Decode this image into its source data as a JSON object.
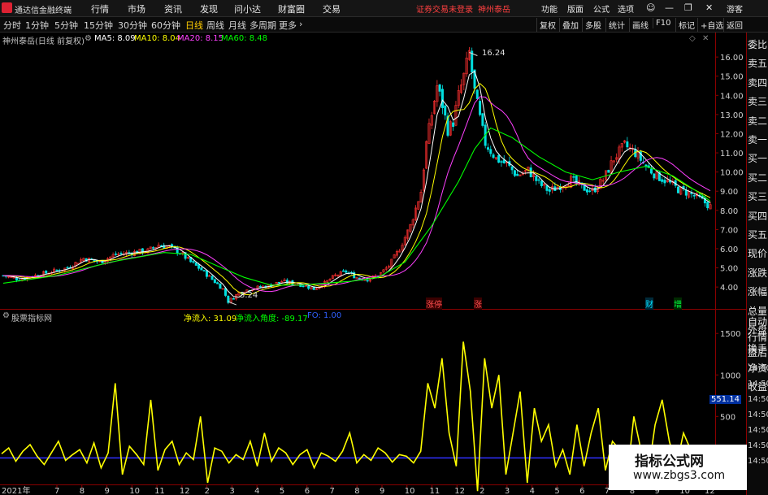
{
  "menubar": {
    "app_name": "通达信金融终端",
    "items": [
      "行情",
      "市场",
      "资讯",
      "发现",
      "问小达",
      "财富圈",
      "交易"
    ],
    "login_warning": "证券交易未登录",
    "stock_name": "神州泰岳",
    "right_items": [
      "功能",
      "版面",
      "公式",
      "选项"
    ],
    "guest": "游客"
  },
  "toolbar": {
    "periods": [
      "分时",
      "1分钟",
      "5分钟",
      "15分钟",
      "30分钟",
      "60分钟",
      "日线",
      "周线",
      "月线",
      "多周期",
      "更多"
    ],
    "active_period": "日线",
    "right_buttons": [
      "复权",
      "叠加",
      "多股",
      "统计",
      "画线",
      "F10",
      "标记",
      "+自选",
      "返回"
    ]
  },
  "info": {
    "title": "神州泰岳(日线 前复权)",
    "ma5": "MA5: 8.09",
    "ma10": "MA10: 8.04",
    "ma20": "MA20: 8.15",
    "ma60": "MA60: 8.48"
  },
  "side_panel": [
    "委比",
    "卖五",
    "卖四",
    "卖三",
    "卖二",
    "卖一",
    "买一",
    "买二",
    "买三",
    "买四",
    "买五",
    "现价",
    "涨跌",
    "涨幅",
    "总量",
    "外盘",
    "换手",
    "净资",
    "收益"
  ],
  "side_panel_lower": [
    "自动",
    "行情",
    "盘后",
    "14:50",
    "14:50",
    "14:50",
    "14:50",
    "14:50",
    "14:50",
    "14:50"
  ],
  "indicator": {
    "name": "股票指标网",
    "line1": "净流入: 31.09",
    "line2": "净流入角度: -89.17",
    "line3": "FO: 1.00",
    "current_value": "551.14"
  },
  "price_axis": [
    "16.00",
    "15.00",
    "14.00",
    "13.00",
    "12.00",
    "11.00",
    "10.00",
    "9.00",
    "8.00",
    "7.00",
    "6.00",
    "5.00",
    "4.00"
  ],
  "indicator_axis": [
    "1500",
    "1000",
    "500",
    "0"
  ],
  "annotations": {
    "high": "16.24",
    "low": "3.24"
  },
  "date_axis": {
    "year": "2021年",
    "months": [
      "7",
      "8",
      "9",
      "10",
      "11",
      "12",
      "2",
      "3",
      "4",
      "5",
      "6",
      "7",
      "8",
      "9",
      "10",
      "11",
      "12",
      "2",
      "3",
      "4",
      "5",
      "6",
      "7",
      "8",
      "9",
      "10",
      "12"
    ]
  },
  "event_tags": [
    "涨停",
    "涨",
    "财",
    "增"
  ],
  "watermark": {
    "line1": "指标公式网",
    "line2": "www.zbgs3.com"
  },
  "colors": {
    "up": "#ff3030",
    "down": "#00e0e0",
    "ma5": "#ffffff",
    "ma10": "#ffff00",
    "ma20": "#ff40ff",
    "ma60": "#00ff00",
    "indicator": "#ffff00",
    "zero_line": "#3030ff"
  },
  "chart_data": {
    "type": "line",
    "title": "神州泰岳(日线 前复权)",
    "ylim": [
      3.2,
      16.6
    ],
    "price_path": [
      [
        0,
        4.6
      ],
      [
        6,
        4.4
      ],
      [
        12,
        4.6
      ],
      [
        18,
        4.8
      ],
      [
        24,
        5.0
      ],
      [
        30,
        5.5
      ],
      [
        36,
        5.3
      ],
      [
        42,
        5.7
      ],
      [
        48,
        5.8
      ],
      [
        54,
        5.9
      ],
      [
        58,
        6.2
      ],
      [
        62,
        6.1
      ],
      [
        66,
        5.8
      ],
      [
        70,
        5.3
      ],
      [
        74,
        4.9
      ],
      [
        78,
        4.4
      ],
      [
        82,
        3.9
      ],
      [
        84,
        3.24
      ],
      [
        88,
        3.7
      ],
      [
        92,
        3.9
      ],
      [
        96,
        4.0
      ],
      [
        100,
        4.1
      ],
      [
        104,
        4.3
      ],
      [
        108,
        4.2
      ],
      [
        112,
        4.1
      ],
      [
        116,
        3.9
      ],
      [
        120,
        4.2
      ],
      [
        124,
        4.6
      ],
      [
        128,
        4.8
      ],
      [
        132,
        4.5
      ],
      [
        136,
        4.4
      ],
      [
        140,
        4.6
      ],
      [
        144,
        5.1
      ],
      [
        148,
        6.0
      ],
      [
        152,
        7.2
      ],
      [
        156,
        9.0
      ],
      [
        158,
        11.5
      ],
      [
        160,
        13.0
      ],
      [
        162,
        14.5
      ],
      [
        164,
        13.5
      ],
      [
        166,
        12.2
      ],
      [
        168,
        12.6
      ],
      [
        170,
        14.0
      ],
      [
        172,
        15.0
      ],
      [
        174,
        16.24
      ],
      [
        176,
        14.2
      ],
      [
        178,
        12.8
      ],
      [
        180,
        11.5
      ],
      [
        184,
        10.7
      ],
      [
        188,
        10.4
      ],
      [
        192,
        9.8
      ],
      [
        196,
        10.1
      ],
      [
        200,
        9.4
      ],
      [
        204,
        9.0
      ],
      [
        208,
        9.3
      ],
      [
        212,
        9.6
      ],
      [
        216,
        9.2
      ],
      [
        220,
        9.0
      ],
      [
        224,
        9.6
      ],
      [
        228,
        10.7
      ],
      [
        232,
        11.4
      ],
      [
        236,
        11.0
      ],
      [
        240,
        10.3
      ],
      [
        244,
        9.8
      ],
      [
        248,
        9.5
      ],
      [
        252,
        9.1
      ],
      [
        256,
        8.9
      ],
      [
        260,
        8.6
      ],
      [
        264,
        8.2
      ]
    ],
    "ma60_path": [
      [
        0,
        4.2
      ],
      [
        20,
        4.6
      ],
      [
        40,
        5.3
      ],
      [
        60,
        5.8
      ],
      [
        70,
        5.7
      ],
      [
        80,
        5.1
      ],
      [
        90,
        4.5
      ],
      [
        100,
        4.1
      ],
      [
        110,
        4.1
      ],
      [
        130,
        4.3
      ],
      [
        140,
        4.5
      ],
      [
        150,
        5.3
      ],
      [
        160,
        7.2
      ],
      [
        170,
        9.5
      ],
      [
        176,
        11.2
      ],
      [
        182,
        12.3
      ],
      [
        190,
        11.8
      ],
      [
        200,
        10.8
      ],
      [
        210,
        10.0
      ],
      [
        220,
        9.6
      ],
      [
        230,
        10.0
      ],
      [
        240,
        10.3
      ],
      [
        250,
        9.8
      ],
      [
        260,
        8.9
      ],
      [
        264,
        8.48
      ]
    ],
    "indicator_ylim": [
      -300,
      1600
    ],
    "indicator_values": [
      50,
      120,
      -40,
      80,
      160,
      20,
      -80,
      60,
      200,
      -30,
      40,
      100,
      -60,
      180,
      -120,
      60,
      900,
      -200,
      140,
      40,
      -80,
      700,
      -150,
      100,
      200,
      -80,
      60,
      -20,
      500,
      -300,
      120,
      80,
      -60,
      40,
      -20,
      200,
      -100,
      300,
      -40,
      120,
      60,
      -80,
      40,
      100,
      -120,
      60,
      20,
      -40,
      80,
      300,
      -60,
      40,
      -30,
      120,
      60,
      -50,
      40,
      20,
      -60,
      80,
      900,
      600,
      1200,
      300,
      -100,
      1400,
      800,
      -400,
      1200,
      600,
      1000,
      -200,
      300,
      800,
      -300,
      600,
      200,
      400,
      -100,
      100,
      -200,
      400,
      -100,
      300,
      600,
      -150,
      200,
      100,
      -300,
      500,
      100,
      -200,
      400,
      700,
      200,
      -100,
      300,
      100,
      -50,
      120,
      31
    ]
  }
}
